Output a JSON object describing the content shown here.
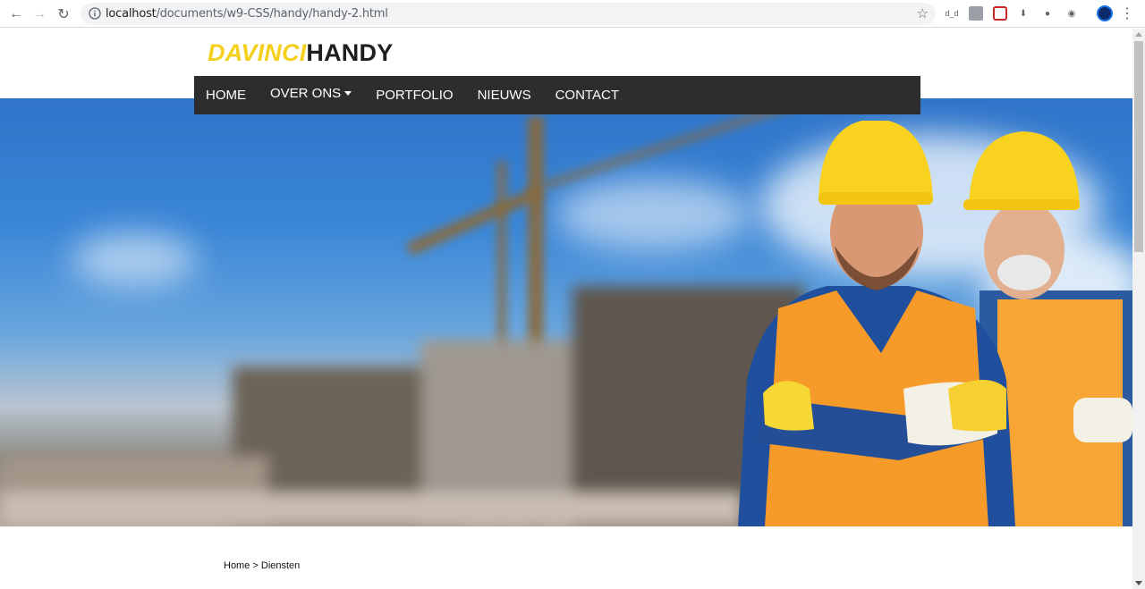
{
  "browser": {
    "url_host": "localhost",
    "url_path": "/documents/w9-CSS/handy/handy-2.html",
    "extension_label": "d_d"
  },
  "site": {
    "logo_part1": "DAVINCI",
    "logo_part2": "HANDY",
    "logo_color_primary": "#f4d01c",
    "logo_color_secondary": "#1e1e1e"
  },
  "nav": {
    "items": [
      {
        "label": "HOME"
      },
      {
        "label": "OVER ONS",
        "has_dropdown": true
      },
      {
        "label": "PORTFOLIO"
      },
      {
        "label": "NIEUWS"
      },
      {
        "label": "CONTACT"
      }
    ],
    "background": "#2d2d2d"
  },
  "hero": {
    "subject": "construction-workers-with-hard-hats"
  },
  "breadcrumb": {
    "text": "Home > Diensten"
  }
}
